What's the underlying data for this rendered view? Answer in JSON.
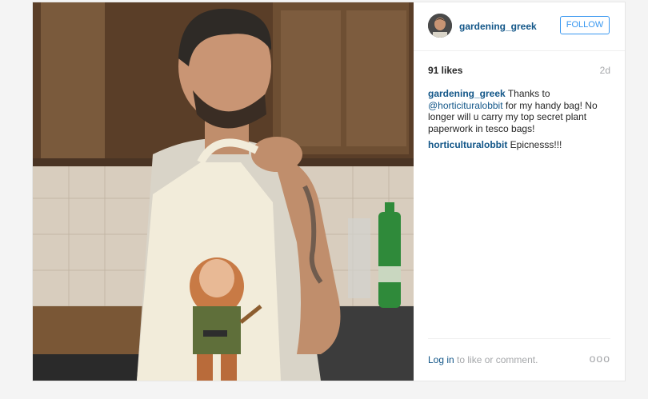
{
  "post": {
    "username": "gardening_greek",
    "follow_label": "FOLLOW",
    "likes": "91 likes",
    "time_ago": "2d",
    "comments": [
      {
        "user": "gardening_greek",
        "text_before": " Thanks to ",
        "mention": "@horticituralobbit",
        "text_after": " for my handy bag! No longer will u carry my top secret plant paperwork in tesco bags!"
      },
      {
        "user": "horticulturalobbit",
        "text_before": " Epicnesss!!!",
        "mention": "",
        "text_after": ""
      }
    ],
    "login_link": "Log in",
    "login_suffix": " to like or comment.",
    "more_label": "ooo"
  },
  "colors": {
    "link": "#125688",
    "follow_blue": "#3897f0",
    "muted": "#a5a7aa"
  }
}
